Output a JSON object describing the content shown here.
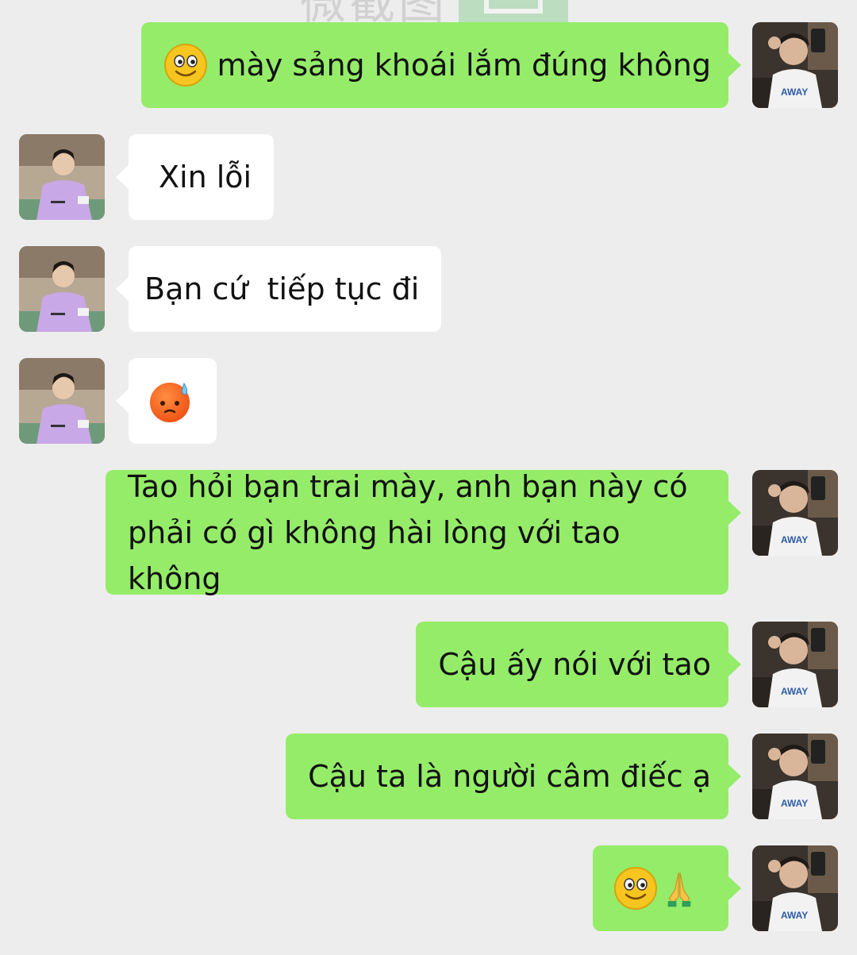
{
  "chat": {
    "watermark": "微截图",
    "messages": [
      {
        "id": "m1",
        "side": "self",
        "emoji": "smile-emoji",
        "text": "mày sảng khoái lắm đúng không"
      },
      {
        "id": "m2",
        "side": "other",
        "text": "Xin lỗi"
      },
      {
        "id": "m3",
        "side": "other",
        "text": "Bạn cứ  tiếp tục đi"
      },
      {
        "id": "m4",
        "side": "other",
        "emoji": "anxious-sweat-emoji",
        "text": ""
      },
      {
        "id": "m5",
        "side": "self",
        "text": "Tao hỏi bạn trai mày, anh bạn này có phải có gì không hài lòng với tao không"
      },
      {
        "id": "m6",
        "side": "self",
        "text": "Cậu ấy nói với tao"
      },
      {
        "id": "m7",
        "side": "self",
        "text": "Cậu ta là người câm điếc ạ"
      },
      {
        "id": "m8",
        "side": "self",
        "emoji": "smile-emoji",
        "emoji2": "pray-hands-emoji",
        "text": ""
      }
    ]
  },
  "colors": {
    "background": "#ededed",
    "self_bubble": "#95ec69",
    "other_bubble": "#ffffff",
    "text": "#111111"
  }
}
